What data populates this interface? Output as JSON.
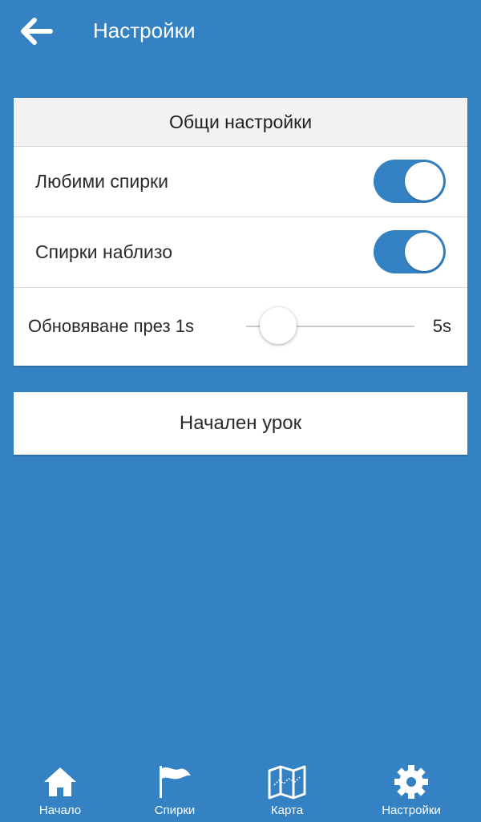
{
  "header": {
    "title": "Настройки",
    "back_icon": "arrow-left-icon"
  },
  "general": {
    "title": "Общи настройки",
    "favorites": {
      "label": "Любими спирки",
      "enabled": true
    },
    "nearby": {
      "label": "Спирки наблизо",
      "enabled": true
    },
    "refresh": {
      "label": "Обновяване през 1s",
      "value": 1,
      "min": 1,
      "max": 5,
      "max_label": "5s"
    }
  },
  "tutorial": {
    "label": "Начален урок"
  },
  "tabs": [
    {
      "label": "Начало",
      "icon": "home-icon"
    },
    {
      "label": "Спирки",
      "icon": "flag-icon"
    },
    {
      "label": "Карта",
      "icon": "map-icon"
    },
    {
      "label": "Настройки",
      "icon": "gear-icon"
    }
  ],
  "colors": {
    "accent": "#3482c3",
    "card": "#ffffff",
    "card_header": "#f2f2f2"
  }
}
